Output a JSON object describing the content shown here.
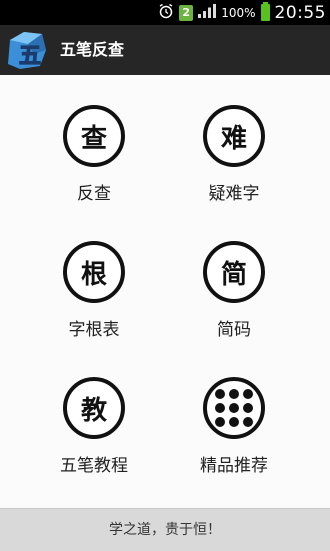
{
  "statusbar": {
    "notification_count": "2",
    "battery_percent": "100%",
    "time": "20:55"
  },
  "titlebar": {
    "title": "五笔反查",
    "logo_char": "五"
  },
  "menu": [
    {
      "glyph": "查",
      "label": "反查",
      "icon": "cha-char-icon"
    },
    {
      "glyph": "难",
      "label": "疑难字",
      "icon": "nan-char-icon"
    },
    {
      "glyph": "根",
      "label": "字根表",
      "icon": "gen-char-icon"
    },
    {
      "glyph": "简",
      "label": "简码",
      "icon": "jian-char-icon"
    },
    {
      "glyph": "教",
      "label": "五笔教程",
      "icon": "jiao-char-icon"
    },
    {
      "glyph": "",
      "label": "精品推荐",
      "icon": "apps-grid-icon"
    }
  ],
  "footer": {
    "slogan": "学之道，贵于恒！"
  },
  "colors": {
    "titlebar_bg": "#262626",
    "footer_bg": "#d9d9d9",
    "battery": "#58c11e"
  }
}
